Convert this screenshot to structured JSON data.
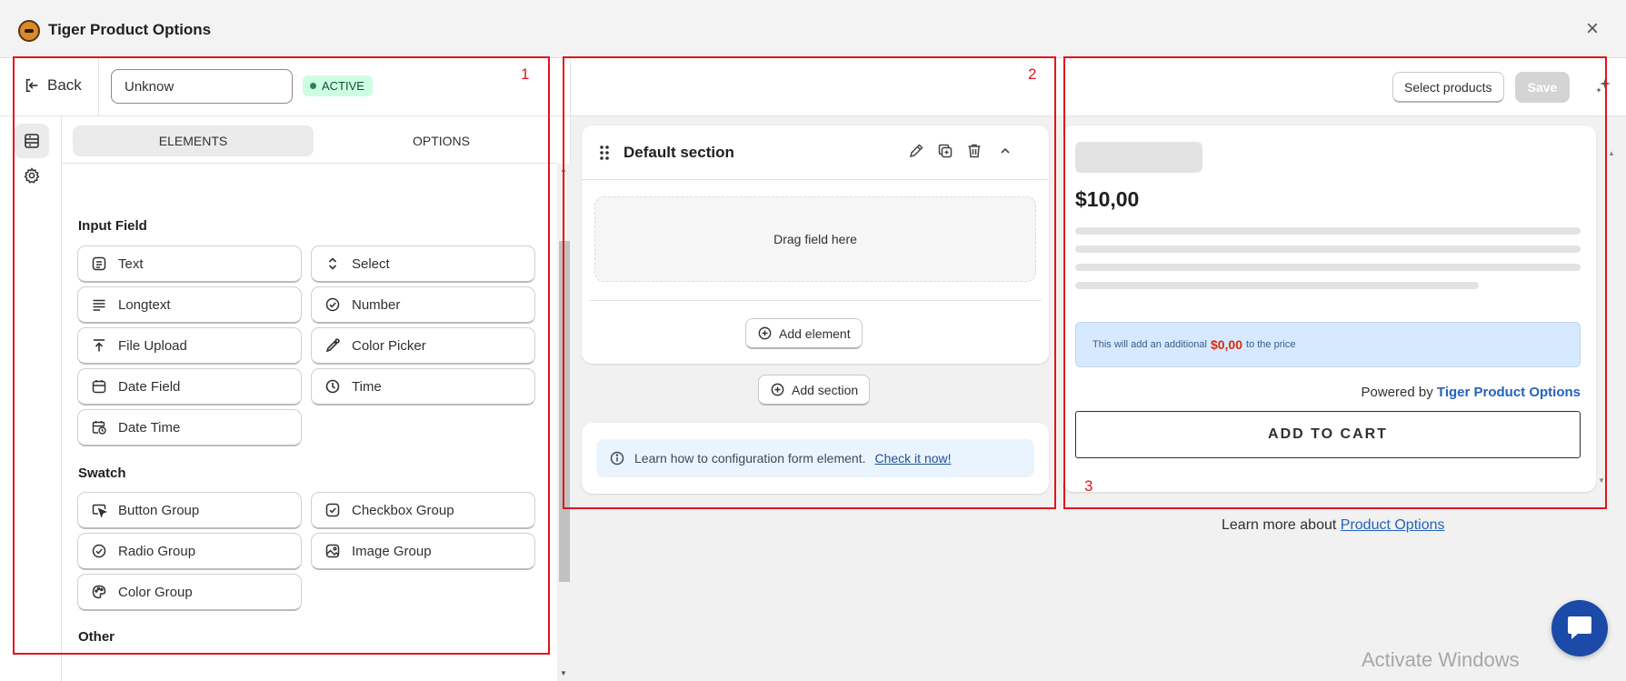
{
  "window": {
    "title": "Tiger Product Options",
    "close_label": "×"
  },
  "left": {
    "back_label": "Back",
    "name_value": "Unknow",
    "status": "ACTIVE",
    "tabs": [
      {
        "label": "ELEMENTS"
      },
      {
        "label": "OPTIONS"
      }
    ],
    "groups": {
      "input_field": {
        "title": "Input Field",
        "items": [
          {
            "label": "Text",
            "icon": "text-icon"
          },
          {
            "label": "Select",
            "icon": "select-icon"
          },
          {
            "label": "Longtext",
            "icon": "longtext-icon"
          },
          {
            "label": "Number",
            "icon": "number-icon"
          },
          {
            "label": "File Upload",
            "icon": "file-upload-icon"
          },
          {
            "label": "Color Picker",
            "icon": "color-picker-icon"
          },
          {
            "label": "Date Field",
            "icon": "calendar-icon"
          },
          {
            "label": "Time",
            "icon": "clock-icon"
          },
          {
            "label": "Date Time",
            "icon": "date-time-icon"
          }
        ]
      },
      "swatch": {
        "title": "Swatch",
        "items": [
          {
            "label": "Button Group",
            "icon": "cursor-icon"
          },
          {
            "label": "Checkbox Group",
            "icon": "checkbox-icon"
          },
          {
            "label": "Radio Group",
            "icon": "radio-icon"
          },
          {
            "label": "Image Group",
            "icon": "image-icon"
          },
          {
            "label": "Color Group",
            "icon": "palette-icon"
          }
        ]
      },
      "other": {
        "title": "Other"
      }
    }
  },
  "middle": {
    "section_title": "Default section",
    "drop_text": "Drag field here",
    "add_element_label": "Add element",
    "add_section_label": "Add section",
    "info_text": "Learn how to configuration form element.",
    "info_link": "Check it now!"
  },
  "right": {
    "select_products_label": "Select products",
    "save_label": "Save",
    "price": "$10,00",
    "addon_prefix": "This will add an additional",
    "addon_amount": "$0,00",
    "addon_suffix": "to the price",
    "powered_prefix": "Powered by",
    "powered_brand": "Tiger Product Options",
    "add_to_cart_label": "ADD TO CART",
    "learn_more_prefix": "Learn more about",
    "learn_more_link": "Product Options"
  },
  "annotations": {
    "one": "1",
    "two": "2",
    "three": "3"
  },
  "watermark": "Activate Windows",
  "colors": {
    "accent_red": "#e3141e",
    "link_blue": "#2463bc",
    "active_green": "#29845a",
    "chat_blue": "#1b4aa8"
  }
}
